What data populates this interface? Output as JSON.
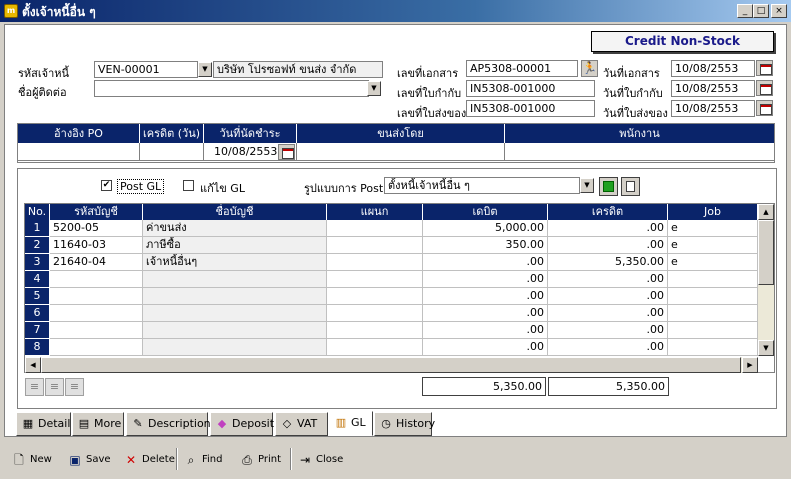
{
  "window": {
    "title": "ตั้งเจ้าหนี้อื่น ๆ",
    "app_icon_text": "m",
    "controls": [
      "_",
      "□",
      "×"
    ]
  },
  "badge": "Credit  Non-Stock",
  "header": {
    "vendor_code_label": "รหัสเจ้าหนี้",
    "vendor_code": "VEN-00001",
    "vendor_name": "บริษัท โปรซอฟท์ ขนส่ง จำกัด",
    "contact_label": "ชื่อผู้ติดต่อ",
    "contact": "",
    "doc_no_label": "เลขที่เอกสาร",
    "doc_no": "AP5308-00001",
    "invoice_no_label": "เลขที่ใบกำกับ",
    "invoice_no": "IN5308-001000",
    "delivery_no_label": "เลขที่ใบส่งของ",
    "delivery_no": "IN5308-001000",
    "doc_date_label": "วันที่เอกสาร",
    "doc_date": "10/08/2553",
    "invoice_date_label": "วันที่ใบกำกับ",
    "invoice_date": "10/08/2553",
    "delivery_date_label": "วันที่ใบส่งของ",
    "delivery_date": "10/08/2553"
  },
  "info_grid": {
    "columns": [
      "อ้างอิง PO",
      "เครดิต (วัน)",
      "วันที่นัดชำระ",
      "ขนส่งโดย",
      "พนักงาน"
    ],
    "values": [
      "",
      "",
      "10/08/2553",
      "",
      ""
    ]
  },
  "gl": {
    "post_gl_label": "Post GL",
    "post_gl_checked": "✔",
    "edit_gl_label": "แก้ไข GL",
    "post_format_label": "รูปแบบการ Post",
    "post_format_value": "ตั้งหนี้เจ้าหนี้อื่น ๆ",
    "columns": [
      "No.",
      "รหัสบัญชี",
      "ชื่อบัญชี",
      "แผนก",
      "เดบิต",
      "เครดิต",
      "Job"
    ],
    "rows": [
      {
        "no": "1",
        "code": "5200-05",
        "name": "ค่าขนส่ง",
        "dept": "",
        "debit": "5,000.00",
        "credit": ".00",
        "job": "e"
      },
      {
        "no": "2",
        "code": "11640-03",
        "name": "ภาษีซื้อ",
        "dept": "",
        "debit": "350.00",
        "credit": ".00",
        "job": "e"
      },
      {
        "no": "3",
        "code": "21640-04",
        "name": "เจ้าหนี้อื่นๆ",
        "dept": "",
        "debit": ".00",
        "credit": "5,350.00",
        "job": "e"
      },
      {
        "no": "4",
        "code": "",
        "name": "",
        "dept": "",
        "debit": ".00",
        "credit": ".00",
        "job": ""
      },
      {
        "no": "5",
        "code": "",
        "name": "",
        "dept": "",
        "debit": ".00",
        "credit": ".00",
        "job": ""
      },
      {
        "no": "6",
        "code": "",
        "name": "",
        "dept": "",
        "debit": ".00",
        "credit": ".00",
        "job": ""
      },
      {
        "no": "7",
        "code": "",
        "name": "",
        "dept": "",
        "debit": ".00",
        "credit": ".00",
        "job": ""
      },
      {
        "no": "8",
        "code": "",
        "name": "",
        "dept": "",
        "debit": ".00",
        "credit": ".00",
        "job": ""
      }
    ],
    "total_debit": "5,350.00",
    "total_credit": "5,350.00"
  },
  "tabs": [
    "Detail",
    "More",
    "Description",
    "Deposit",
    "VAT",
    "GL",
    "History"
  ],
  "toolbar": {
    "new": "New",
    "save": "Save",
    "delete": "Delete",
    "find": "Find",
    "print": "Print",
    "close": "Close"
  }
}
